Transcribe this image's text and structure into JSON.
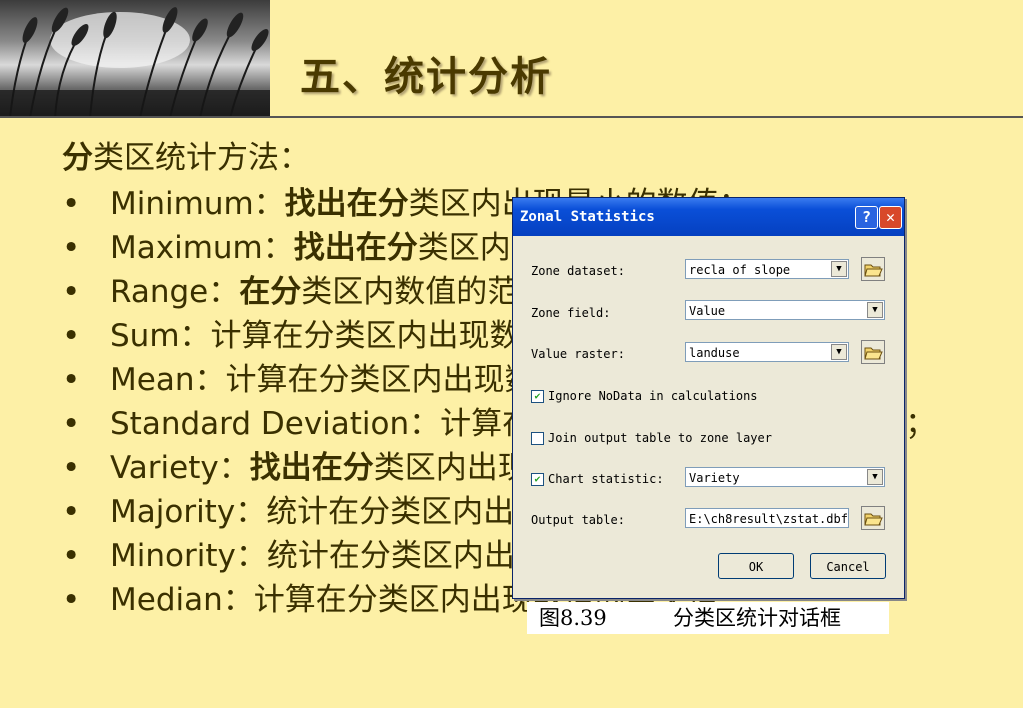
{
  "title": "五、统计分析",
  "intro": {
    "bold_char": "分",
    "text": "类区统计方法："
  },
  "bullet": "•",
  "items": [
    {
      "term": "Minimum",
      "colon": "：",
      "bold": "找出在分",
      "rest": "类区内出现最小的数值；"
    },
    {
      "term": "Maximum",
      "colon": "：",
      "bold": "找出在分",
      "rest": "类区内出现最大的数值；"
    },
    {
      "term": "Range",
      "colon": "：",
      "bold": "在分",
      "rest": "类区内数值的范围；"
    },
    {
      "term": "Sum",
      "colon": "：",
      "bold": "",
      "rest": "计算在分类区内出现数值的总和；"
    },
    {
      "term": "Mean",
      "colon": "：",
      "bold": "",
      "rest": "计算在分类区内出现数值的平均值；"
    },
    {
      "term": "Standard Deviation",
      "colon": "：",
      "bold": "",
      "rest": "计算在分类区内出现数值的标准差；"
    },
    {
      "term": "Variety",
      "colon": "：",
      "bold": "找出在分",
      "rest": "类区内出现不同数值的个数；"
    },
    {
      "term": "Majority",
      "colon": "：",
      "bold": "",
      "rest": "统计在分类区内出现最多的数值；"
    },
    {
      "term": "Minority",
      "colon": "：",
      "bold": "",
      "rest": "统计在分类区内出现最少的数值；"
    },
    {
      "term": "Median",
      "colon": "：",
      "bold": "",
      "rest": "计算在分类区内出现数值的中央值。"
    }
  ],
  "dialog": {
    "title": "Zonal Statistics",
    "help": "?",
    "close": "✕",
    "zone_dataset_label": "Zone dataset:",
    "zone_dataset_value": "recla of slope",
    "zone_field_label": "Zone field:",
    "zone_field_value": "Value",
    "value_raster_label": "Value raster:",
    "value_raster_value": "landuse",
    "ignore_nodata_label": "Ignore NoData in calculations",
    "ignore_nodata_checked": true,
    "join_output_label": "Join output table to zone layer",
    "join_output_checked": false,
    "chart_statistic_label": "Chart statistic:",
    "chart_statistic_checked": true,
    "chart_statistic_value": "Variety",
    "output_table_label": "Output table:",
    "output_table_value": "E:\\ch8result\\zstat.dbf",
    "ok_label": "OK",
    "cancel_label": "Cancel",
    "check_glyph": "✔",
    "arrow_glyph": "▼",
    "folder_icon": "open-folder-icon"
  },
  "caption": {
    "number": "图8.39",
    "text": "分类区统计对话框"
  }
}
